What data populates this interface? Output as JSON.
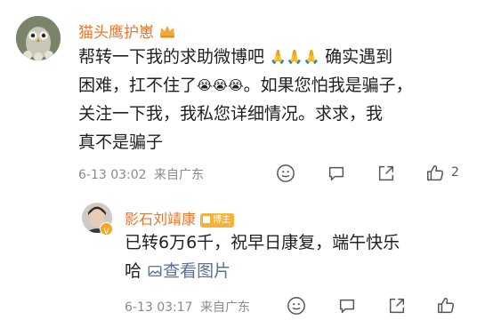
{
  "comment": {
    "username": "猫头鹰护崽",
    "text_line1": "帮转一下我的求助微博吧",
    "text_line1b": "确实遇到",
    "text_line2": "困难，扛不住了",
    "text_line2b": "。如果您怕我是骗子，",
    "text_line3": "关注一下我，我私您详细情况。求求，我",
    "text_line4": "真不是骗子",
    "timestamp": "6-13 03:02",
    "location": "来自广东",
    "like_count": "2",
    "pray_emoji": "🙏",
    "cry_emoji": "😭"
  },
  "reply": {
    "username": "影石刘靖康",
    "badge": "博主",
    "text_line1": "已转6万6千，祝早日康复，端午快乐",
    "text_line2": "哈",
    "view_image_label": "查看图片",
    "timestamp": "6-13 03:17",
    "location": "来自广东"
  },
  "icons": [
    "smiley-icon",
    "reply-icon",
    "share-icon",
    "like-icon",
    "image-icon",
    "crown-icon"
  ],
  "colors": {
    "username": "#e8762d",
    "link": "#5a6f9a",
    "meta": "#8a8a8a",
    "badge": "#f3b23a"
  }
}
